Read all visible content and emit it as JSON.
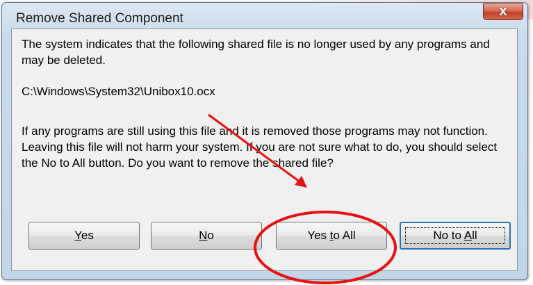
{
  "dialog": {
    "title": "Remove Shared Component",
    "close_glyph": "X",
    "message_1": "The system indicates that the following shared file is no longer used by any programs and may be deleted.",
    "file_path": "C:\\Windows\\System32\\Unibox10.ocx",
    "message_2": "If any programs are still using this file and it is removed those programs may not function. Leaving this file will not harm your system. If you are not sure what to do, you should select the No to All button. Do you want to remove the shared file?"
  },
  "buttons": {
    "yes": {
      "pre": "",
      "key": "Y",
      "post": "es"
    },
    "no": {
      "pre": "",
      "key": "N",
      "post": "o"
    },
    "yes_to_all": {
      "pre": "Yes ",
      "key": "t",
      "post": "o All"
    },
    "no_to_all": {
      "pre": "No to ",
      "key": "A",
      "post": "ll"
    }
  },
  "annotation": {
    "color": "#e81010"
  },
  "colors": {
    "close_button": "#c9432c",
    "focus_border": "#2d6fb5"
  }
}
